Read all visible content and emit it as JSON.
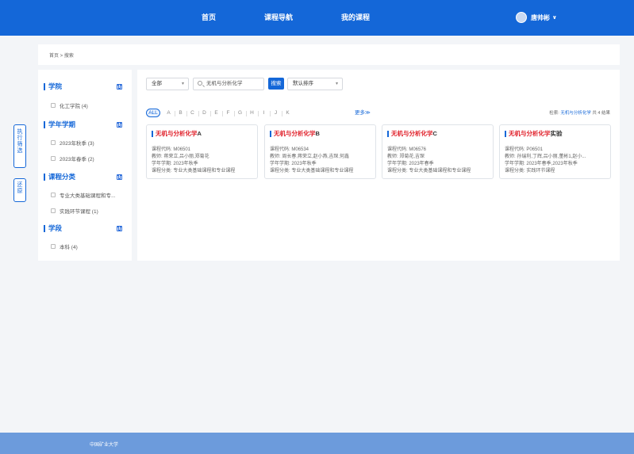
{
  "nav": {
    "items": [
      "首页",
      "课程导航",
      "我的课程"
    ],
    "user": "唐帅彬"
  },
  "breadcrumb": "首页 >  搜索",
  "side_buttons": [
    "执行筛选",
    "还原"
  ],
  "sidebar": {
    "sections": [
      {
        "title": "学院",
        "options": [
          "化工学院 (4)"
        ]
      },
      {
        "title": "学年学期",
        "options": [
          "2023年秋季 (3)",
          "2023年春季 (2)"
        ]
      },
      {
        "title": "课程分类",
        "options": [
          "专业大类基础课程和专...",
          "实践环节课程 (1)"
        ]
      },
      {
        "title": "学段",
        "options": [
          "本科 (4)"
        ]
      }
    ]
  },
  "filters": {
    "scope": "全部",
    "search_value": "无机与分析化学",
    "search_button": "搜索",
    "sort": "默认排序"
  },
  "letters": [
    "ALL",
    "A",
    "B",
    "C",
    "D",
    "E",
    "F",
    "G",
    "H",
    "I",
    "J",
    "K"
  ],
  "more": "更多≫",
  "result": {
    "prefix": "检索",
    "keyword": "无机与分析化学",
    "suffix": "共 4 结果"
  },
  "cards": [
    {
      "title_hl": "无机与分析化学",
      "title_rest": "A",
      "code": "课程代码: M06501",
      "teacher": "教师: 蒋荣立,吕小丽,郑菊花",
      "term": "学年学期: 2023年秋季",
      "category": "课程分类: 专业大类基础课程和专业课程"
    },
    {
      "title_hl": "无机与分析化学",
      "title_rest": "B",
      "code": "课程代码: M06534",
      "teacher": "教师: 周长春,蒋荣立,赵小燕,吉琛,何鑫",
      "term": "学年学期: 2023年秋季",
      "category": "课程分类: 专业大类基础课程和专业课程"
    },
    {
      "title_hl": "无机与分析化学",
      "title_rest": "C",
      "code": "课程代码: M06576",
      "teacher": "教师: 郑菊花,吉琛",
      "term": "学年学期: 2023年春季",
      "category": "课程分类: 专业大类基础课程和专业课程"
    },
    {
      "title_hl": "无机与分析化学",
      "title_rest": "实验",
      "code": "课程代码: P06501",
      "teacher": "教师: 孙瑞利,丁辉,吕小丽,董彬1,赵小...",
      "term": "学年学期: 2023年春季,2023年秋季",
      "category": "课程分类: 实践环节课程"
    }
  ],
  "footer": "中国矿业大学"
}
